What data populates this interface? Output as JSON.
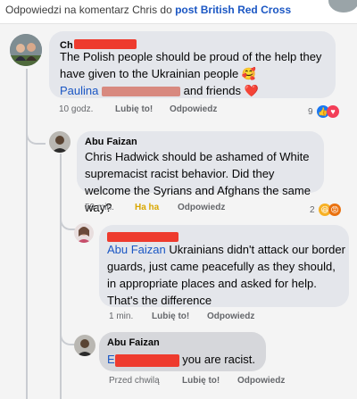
{
  "header": {
    "prefix": "Odpowiedzi na komentarz Chris do ",
    "post_link": "post British Red Cross"
  },
  "comments": [
    {
      "author_visible": "Ch",
      "text": "The Polish people should be proud of the help they have given to the Ukrainian people 🥰",
      "mention_visible": "Paulina",
      "text_after_mention": "and friends ❤️",
      "time": "10 godz.",
      "like_label": "Lubię to!",
      "reply_label": "Odpowiedz",
      "reaction_count": "9"
    },
    {
      "author": "Abu Faizan",
      "text": "Chris Hadwick should be ashamed of White supremacist racist behavior. Did they welcome the Syrians and Afghans the same way?",
      "time": "59 min.",
      "like_label": "Ha ha",
      "reply_label": "Odpowiedz",
      "reaction_count": "2"
    },
    {
      "mention": "Abu Faizan",
      "text": "Ukrainians didn't attack our border guards, just came peacefully as they should, in appropriate places and asked for help. That's the difference",
      "time": "1 min.",
      "like_label": "Lubię to!",
      "reply_label": "Odpowiedz"
    },
    {
      "author": "Abu Faizan",
      "mention_visible": "E",
      "text": "you are racist.",
      "time": "Przed chwilą",
      "like_label": "Lubię to!",
      "reply_label": "Odpowiedz"
    }
  ],
  "icons": {
    "love": "heart",
    "like": "thumbs-up",
    "haha": "laughing-face",
    "angry": "angry-face"
  },
  "colors": {
    "link": "#1b57c4",
    "like_blue": "#1877f2",
    "haha_yellow": "#d9a700",
    "redaction": "#ee3b2e"
  }
}
